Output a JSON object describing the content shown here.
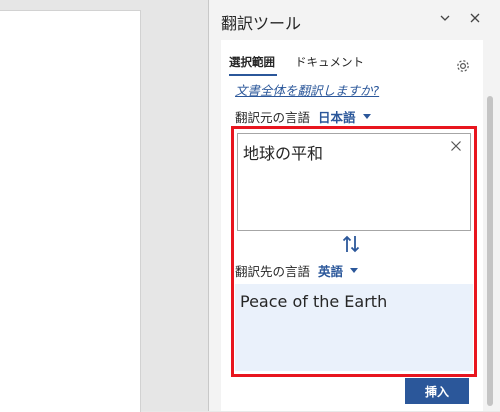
{
  "pane": {
    "title": "翻訳ツール"
  },
  "tabs": [
    {
      "label": "選択範囲",
      "active": true
    },
    {
      "label": "ドキュメント",
      "active": false
    }
  ],
  "translate_doc_link": "文書全体を翻訳しますか?",
  "source": {
    "label": "翻訳元の言語",
    "language": "日本語",
    "text": "地球の平和"
  },
  "target": {
    "label": "翻訳先の言語",
    "language": "英語",
    "text": "Peace of the Earth"
  },
  "insert_label": "挿入",
  "icons": {
    "pane_menu": "chevron-down-icon",
    "pane_close": "close-icon",
    "settings": "gear-icon",
    "clear": "close-icon",
    "swap": "swap-arrows-icon",
    "dropdown": "caret-down-icon"
  },
  "colors": {
    "accent": "#2b579a",
    "highlight": "#e8151e",
    "output_bg": "#eaf1fb"
  }
}
